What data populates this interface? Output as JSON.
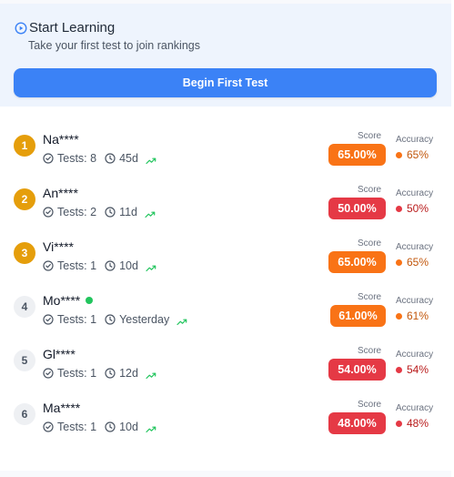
{
  "start": {
    "title": "Start Learning",
    "subtitle": "Take your first test to join rankings",
    "button_label": "Begin First Test"
  },
  "labels": {
    "score": "Score",
    "accuracy": "Accuracy"
  },
  "colors": {
    "primary": "#3b82f6",
    "gold": "#e59e0b",
    "score_orange": "#f97316",
    "score_red": "#e53945",
    "online": "#22c55e"
  },
  "leaderboard": [
    {
      "rank": "1",
      "name": "Na****",
      "online": false,
      "tests": "Tests: 8",
      "last_active": "45d",
      "score": "65.00%",
      "score_color": "orange",
      "accuracy": "65%",
      "accuracy_color": "orange"
    },
    {
      "rank": "2",
      "name": "An****",
      "online": false,
      "tests": "Tests: 2",
      "last_active": "11d",
      "score": "50.00%",
      "score_color": "red",
      "accuracy": "50%",
      "accuracy_color": "red"
    },
    {
      "rank": "3",
      "name": "Vi****",
      "online": false,
      "tests": "Tests: 1",
      "last_active": "10d",
      "score": "65.00%",
      "score_color": "orange",
      "accuracy": "65%",
      "accuracy_color": "orange"
    },
    {
      "rank": "4",
      "name": "Mo****",
      "online": true,
      "tests": "Tests: 1",
      "last_active": "Yesterday",
      "score": "61.00%",
      "score_color": "orange",
      "accuracy": "61%",
      "accuracy_color": "orange"
    },
    {
      "rank": "5",
      "name": "Gl****",
      "online": false,
      "tests": "Tests: 1",
      "last_active": "12d",
      "score": "54.00%",
      "score_color": "red",
      "accuracy": "54%",
      "accuracy_color": "red"
    },
    {
      "rank": "6",
      "name": "Ma****",
      "online": false,
      "tests": "Tests: 1",
      "last_active": "10d",
      "score": "48.00%",
      "score_color": "red",
      "accuracy": "48%",
      "accuracy_color": "red"
    }
  ],
  "icons": {
    "start": "play-circle-icon",
    "tests": "check-circle-icon",
    "time": "clock-icon",
    "trend": "trending-up-icon"
  }
}
